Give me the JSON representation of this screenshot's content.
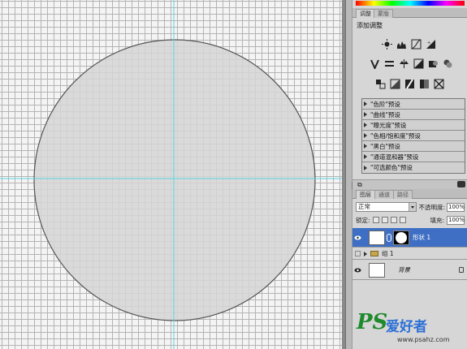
{
  "panels": {
    "adjust_tabs": [
      "调整",
      "蒙版"
    ],
    "adjust_title": "添加调整",
    "presets": [
      "\"色阶\"预设",
      "\"曲线\"预设",
      "\"曝光度\"预设",
      "\"色相/饱和度\"预设",
      "\"黑白\"预设",
      "\"通道混和器\"预设",
      "\"可选颜色\"预设"
    ],
    "layer_tabs": [
      "图层",
      "通道",
      "路径"
    ]
  },
  "layers": {
    "blend_mode": "正常",
    "opacity_label": "不透明度:",
    "opacity_value": "100%",
    "lock_label": "锁定:",
    "fill_label": "填充:",
    "fill_value": "100%",
    "items": [
      {
        "name": "形状 1",
        "selected": true
      },
      {
        "name": "组 1",
        "selected": false
      },
      {
        "name": "背景",
        "selected": false
      }
    ]
  },
  "watermark": {
    "ps": "PS",
    "cn": "爱好者",
    "url": "www.psahz.com"
  },
  "colors": {
    "circle_fill": "#d5d5d5",
    "circle_stroke": "#555555",
    "guide": "#5ad6e0",
    "selected_layer": "#3e6fc4"
  }
}
